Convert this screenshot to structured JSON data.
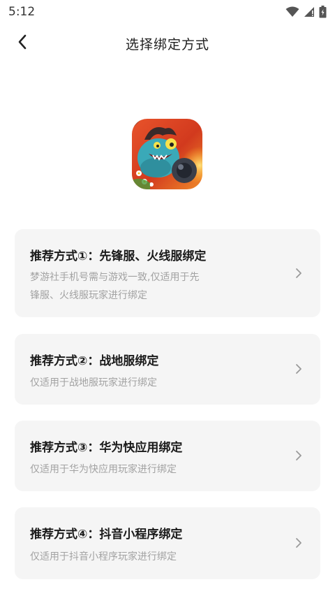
{
  "status_bar": {
    "time": "5:12",
    "icons": [
      "wifi-icon",
      "signal-icon",
      "battery-icon"
    ]
  },
  "header": {
    "back_icon": "chevron-left-icon",
    "title": "选择绑定方式"
  },
  "app": {
    "icon": "game-character-icon"
  },
  "options": [
    {
      "title": "推荐方式①：先锋服、火线服绑定",
      "desc_line1": "梦游社手机号需与游戏一致,仅适用于先",
      "desc_line2": "锋服、火线服玩家进行绑定"
    },
    {
      "title": "推荐方式②：战地服绑定",
      "desc_line1": "仅适用于战地服玩家进行绑定"
    },
    {
      "title": "推荐方式③：华为快应用绑定",
      "desc_line1": "仅适用于华为快应用玩家进行绑定"
    },
    {
      "title": "推荐方式④：抖音小程序绑定",
      "desc_line1": "仅适用于抖音小程序玩家进行绑定"
    }
  ],
  "colors": {
    "card_bg": "#f5f5f5",
    "desc_text": "#a2a2a2",
    "title_text": "#1a1a1a"
  }
}
